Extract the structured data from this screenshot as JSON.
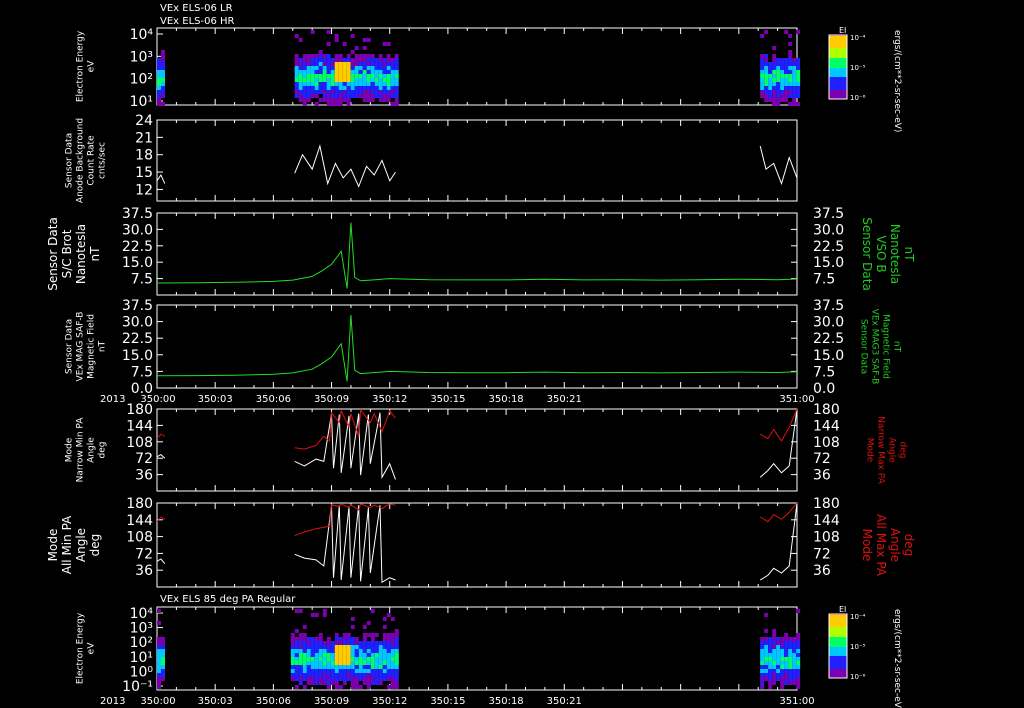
{
  "header": {
    "line1": "VEx ELS-06 LR",
    "line2": "VEx ELS-06 HR"
  },
  "time_axis": {
    "year": "2013",
    "ticks": [
      "350:00",
      "350:03",
      "350:06",
      "350:09",
      "350:12",
      "350:15",
      "350:18",
      "350:21",
      "351:00"
    ]
  },
  "colors": {
    "white_trace": "#ffffff",
    "green_trace": "#22dd22",
    "red_trace": "#dd1111",
    "green_label": "#22cc22",
    "red_label": "#dd1111"
  },
  "chart_data": [
    {
      "type": "heatmap",
      "panel": "electron-energy-lr-hr",
      "ylabel": [
        "Electron Energy",
        "eV"
      ],
      "yticks": [
        "10⁴",
        "10³",
        "10²",
        "10¹"
      ],
      "colorbar": {
        "title": "EI",
        "ticks": [
          "10⁻⁴",
          "10⁻⁵",
          "10⁻⁶"
        ],
        "unit": "ergs/(cm**2-sr-sec-eV)"
      },
      "data_segments": [
        [
          0.0,
          0.4
        ],
        [
          7.1,
          12.3
        ],
        [
          31.1,
          33.0
        ]
      ],
      "bright_spots": [
        9.5
      ]
    },
    {
      "type": "line",
      "panel": "anode-background",
      "ylabel": [
        "Sensor Data",
        "Anode Background",
        "Count Rate",
        "cnts/sec"
      ],
      "yticks": [
        "24",
        "21",
        "18",
        "15",
        "12"
      ],
      "ylim": [
        10,
        24
      ],
      "series": [
        {
          "color": "white",
          "segments": [
            {
              "x": [
                0.0,
                0.2,
                0.4
              ],
              "y": [
                13.5,
                14.5,
                13.0
              ]
            },
            {
              "x": [
                7.1,
                7.5,
                8.0,
                8.4,
                8.8,
                9.2,
                9.6,
                10.0,
                10.4,
                10.8,
                11.2,
                11.6,
                12.0,
                12.3
              ],
              "y": [
                14.8,
                18.0,
                15.5,
                19.5,
                13.0,
                16.5,
                14.0,
                15.5,
                12.5,
                16.0,
                14.5,
                17.0,
                13.5,
                15.0
              ]
            },
            {
              "x": [
                31.1,
                31.4,
                31.8,
                32.2,
                32.6,
                33.0
              ],
              "y": [
                19.5,
                15.5,
                16.5,
                13.0,
                17.5,
                14.0
              ]
            }
          ]
        }
      ]
    },
    {
      "type": "line",
      "panel": "sc-brot",
      "ylabel": [
        "Sensor Data",
        "S/C Brot",
        "Nanotesla",
        "nT"
      ],
      "ylabel_right": [
        "Sensor Data",
        "VSO B",
        "Nanotesla",
        "nT"
      ],
      "yticks": [
        "37.5",
        "30.0",
        "22.5",
        "15.0",
        "7.5"
      ],
      "ylim": [
        0,
        37.5
      ],
      "series": [
        {
          "color": "green",
          "segments": [
            {
              "x": [
                0,
                2,
                4,
                6,
                7,
                8,
                8.5,
                9.0,
                9.5,
                9.8,
                10.0,
                10.2,
                10.5,
                11,
                12,
                14,
                16,
                18,
                20,
                22,
                24,
                26,
                28,
                30,
                32,
                33
              ],
              "y": [
                5.5,
                5.6,
                5.8,
                6.2,
                6.8,
                8.5,
                11.0,
                14.0,
                20.0,
                3.0,
                33.0,
                8.0,
                6.5,
                6.8,
                7.5,
                7.0,
                6.9,
                6.9,
                7.2,
                6.9,
                7.0,
                6.8,
                7.0,
                7.2,
                7.0,
                7.3
              ]
            }
          ]
        }
      ]
    },
    {
      "type": "line",
      "panel": "mag-saf-b",
      "ylabel": [
        "Sensor Data",
        "VEx MAG SAF-B",
        "Magnetic Field",
        "nT"
      ],
      "ylabel_right": [
        "Sensor Data",
        "VEx MAG3 SAF-B",
        "Magnetic Field",
        "nT"
      ],
      "yticks": [
        "37.5",
        "30.0",
        "22.5",
        "15.0",
        "7.5",
        "0.0"
      ],
      "ylim": [
        0,
        37.5
      ],
      "series": [
        {
          "color": "green",
          "segments": [
            {
              "x": [
                0,
                2,
                4,
                6,
                7,
                8,
                8.5,
                9.0,
                9.5,
                9.8,
                10.0,
                10.2,
                10.5,
                11,
                12,
                14,
                16,
                18,
                20,
                22,
                24,
                26,
                28,
                30,
                32,
                33
              ],
              "y": [
                5.5,
                5.6,
                5.8,
                6.2,
                6.8,
                8.5,
                11.0,
                14.0,
                20.0,
                3.0,
                33.0,
                8.0,
                6.5,
                6.8,
                7.5,
                7.0,
                6.9,
                6.9,
                7.2,
                6.9,
                7.0,
                6.8,
                7.0,
                7.2,
                7.0,
                7.3
              ]
            }
          ]
        }
      ]
    },
    {
      "type": "line",
      "panel": "narrow-pa",
      "ylabel": [
        "Mode",
        "Narrow Min PA",
        "Angle",
        "deg"
      ],
      "ylabel_right": [
        "Mode",
        "Narrow Max PA",
        "Angle",
        "deg"
      ],
      "yticks": [
        "180",
        "144",
        "108",
        "72",
        "36"
      ],
      "ylim": [
        0,
        180
      ],
      "series": [
        {
          "color": "white",
          "segments": [
            {
              "x": [
                0.0,
                0.2,
                0.4
              ],
              "y": [
                75,
                80,
                72
              ]
            },
            {
              "x": [
                7.1,
                7.6,
                8.2,
                8.6,
                9.0,
                9.1,
                9.4,
                9.5,
                9.9,
                10.0,
                10.4,
                10.5,
                10.9,
                11.0,
                11.5,
                11.6,
                12.0,
                12.3
              ],
              "y": [
                65,
                55,
                70,
                65,
                170,
                50,
                168,
                40,
                165,
                50,
                170,
                35,
                168,
                60,
                172,
                30,
                60,
                25
              ]
            },
            {
              "x": [
                31.1,
                31.5,
                31.8,
                32.2,
                32.6,
                33.0
              ],
              "y": [
                30,
                45,
                60,
                40,
                55,
                180
              ]
            }
          ]
        },
        {
          "color": "red",
          "segments": [
            {
              "x": [
                0.0,
                0.2,
                0.4
              ],
              "y": [
                115,
                125,
                120
              ]
            },
            {
              "x": [
                7.1,
                7.6,
                8.2,
                8.6,
                8.9,
                9.0,
                9.4,
                9.5,
                9.9,
                10.0,
                10.4,
                10.5,
                11.0,
                11.2,
                11.6,
                12.0,
                12.3
              ],
              "y": [
                95,
                92,
                100,
                120,
                110,
                172,
                150,
                176,
                140,
                170,
                120,
                178,
                150,
                170,
                130,
                176,
                160
              ]
            },
            {
              "x": [
                31.1,
                31.5,
                31.8,
                32.2,
                32.6,
                33.0
              ],
              "y": [
                125,
                115,
                135,
                110,
                140,
                180
              ]
            }
          ]
        }
      ]
    },
    {
      "type": "line",
      "panel": "all-pa",
      "ylabel": [
        "Mode",
        "All Min PA",
        "Angle",
        "deg"
      ],
      "ylabel_right": [
        "Mode",
        "All Max PA",
        "Angle",
        "deg"
      ],
      "yticks": [
        "180",
        "144",
        "108",
        "72",
        "36"
      ],
      "ylim": [
        0,
        180
      ],
      "series": [
        {
          "color": "white",
          "segments": [
            {
              "x": [
                0.0,
                0.2,
                0.4
              ],
              "y": [
                55,
                60,
                50
              ]
            },
            {
              "x": [
                7.1,
                7.6,
                8.2,
                8.6,
                9.0,
                9.1,
                9.4,
                9.5,
                9.9,
                10.0,
                10.4,
                10.5,
                10.9,
                11.0,
                11.5,
                11.6,
                12.0,
                12.3
              ],
              "y": [
                70,
                62,
                58,
                45,
                175,
                20,
                175,
                15,
                172,
                20,
                175,
                12,
                170,
                30,
                175,
                10,
                20,
                15
              ]
            },
            {
              "x": [
                31.1,
                31.5,
                31.8,
                32.2,
                32.6,
                33.0
              ],
              "y": [
                15,
                25,
                40,
                30,
                45,
                180
              ]
            }
          ]
        },
        {
          "color": "red",
          "segments": [
            {
              "x": [
                0.0,
                0.2,
                0.4
              ],
              "y": [
                140,
                150,
                145
              ]
            },
            {
              "x": [
                7.1,
                7.6,
                8.2,
                8.6,
                8.9,
                9.0,
                9.4,
                9.5,
                9.9,
                10.0,
                10.4,
                10.5,
                11.0,
                11.2,
                11.6,
                12.0,
                12.3
              ],
              "y": [
                110,
                118,
                125,
                128,
                130,
                176,
                172,
                178,
                170,
                176,
                165,
                178,
                170,
                176,
                168,
                178,
                175
              ]
            },
            {
              "x": [
                31.1,
                31.5,
                31.8,
                32.2,
                32.6,
                33.0
              ],
              "y": [
                150,
                140,
                155,
                145,
                160,
                180
              ]
            }
          ]
        }
      ]
    },
    {
      "type": "heatmap",
      "panel": "electron-energy-85pa",
      "title": "VEx ELS 85 deg PA Regular",
      "ylabel": [
        "Electron Energy",
        "eV"
      ],
      "yticks": [
        "10⁴",
        "10³",
        "10²",
        "10¹",
        "10⁰",
        "10⁻¹"
      ],
      "colorbar": {
        "title": "EI",
        "ticks": [
          "10⁻⁴",
          "10⁻⁵",
          "10⁻⁶"
        ],
        "unit": "ergs/(cm**2-sr-sec-eV)"
      },
      "data_segments": [
        [
          0.0,
          0.4
        ],
        [
          6.9,
          12.3
        ],
        [
          31.1,
          33.0
        ]
      ],
      "bright_spots": [
        9.5
      ]
    }
  ]
}
